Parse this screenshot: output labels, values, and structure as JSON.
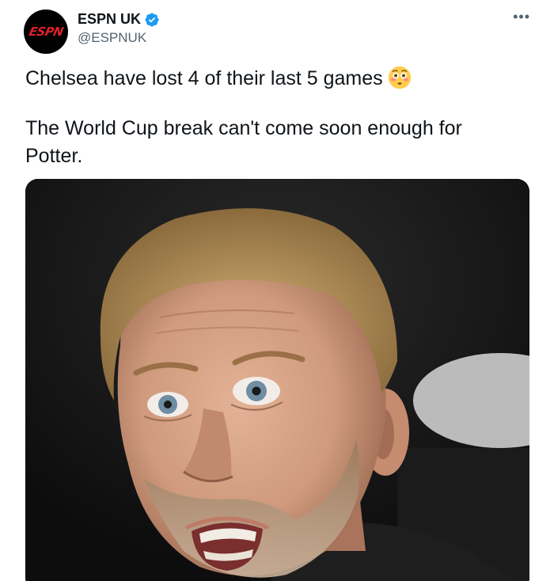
{
  "author": {
    "display_name": "ESPN UK",
    "handle": "@ESPNUK",
    "avatar_logo": "ESPN",
    "verified": true
  },
  "tweet": {
    "line1": "Chelsea have lost 4 of their last 5 games",
    "line1_emoji": "flushed-face-emoji",
    "line2": "The World Cup break can't come soon enough for Potter."
  },
  "menu": {
    "more_icon": "more-icon"
  },
  "media": {
    "description_icon": "photo",
    "colors": {
      "background": "#141414",
      "hair": "#b9955f",
      "skin": "#d09a7e"
    }
  },
  "colors": {
    "verified": "#1d9bf0",
    "brand_red": "#e0202c",
    "text_primary": "#0f1419",
    "text_secondary": "#536471"
  }
}
